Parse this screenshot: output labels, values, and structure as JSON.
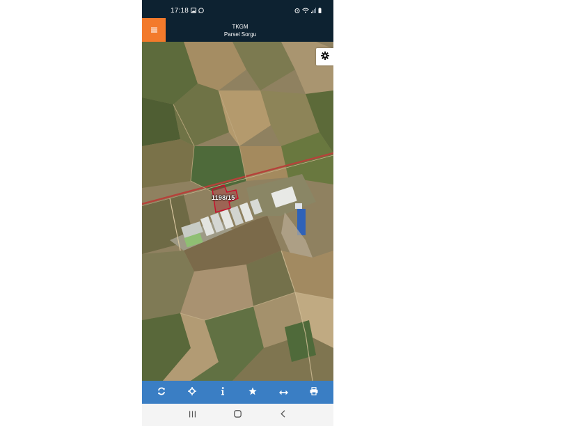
{
  "status_bar": {
    "time": "17:18",
    "left_icons": [
      "gallery-icon",
      "whatsapp-icon"
    ],
    "right_icons": [
      "alarm-icon",
      "wifi-icon",
      "signal-icon",
      "battery-icon"
    ]
  },
  "header": {
    "menu_icon": "hamburger-menu-icon",
    "title": "TKGM",
    "subtitle": "Parsel Sorgu",
    "accent_color": "#f37a2b",
    "background_color": "#0d2231"
  },
  "map": {
    "settings_icon": "gear-icon",
    "parcel_label": "1198/15",
    "parcel_outline_color": "#c8102e"
  },
  "toolbar": {
    "background_color": "#3a7ec4",
    "items": [
      {
        "icon": "refresh-icon"
      },
      {
        "icon": "locate-icon"
      },
      {
        "icon": "info-icon"
      },
      {
        "icon": "star-icon"
      },
      {
        "icon": "measure-icon"
      },
      {
        "icon": "print-icon"
      }
    ]
  },
  "nav_bar": {
    "items": [
      {
        "icon": "recent-apps-icon"
      },
      {
        "icon": "home-icon"
      },
      {
        "icon": "back-icon"
      }
    ]
  }
}
